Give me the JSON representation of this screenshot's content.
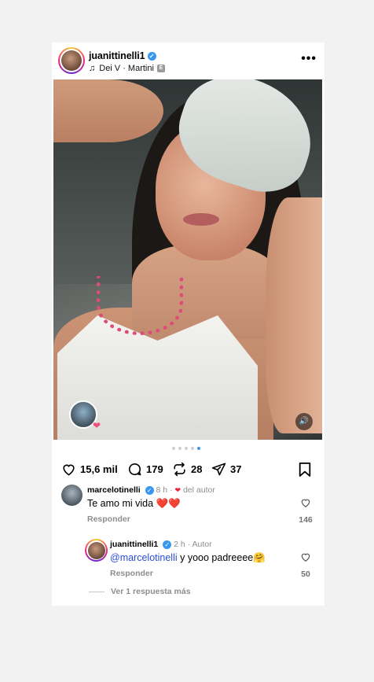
{
  "post": {
    "username": "juanittinelli1",
    "verified_mark": "✓",
    "music_note_icon": "♫",
    "music": "Dei V · Martini",
    "explicit_badge": "E",
    "more_icon": "•••"
  },
  "carousel": {
    "total": 5,
    "active_index": 4
  },
  "actions": {
    "likes": "15,6 mil",
    "comments": "179",
    "reposts": "28",
    "shares": "37"
  },
  "comments": [
    {
      "username": "marcelotinelli",
      "time": "8 h",
      "liked_by_author_heart": "❤",
      "liked_by_author_label": "del autor",
      "text": "Te amo mi vida ❤️❤️",
      "reply_label": "Responder",
      "likes": "146"
    },
    {
      "username": "juanittinelli1",
      "time": "2 h",
      "author_label": "Autor",
      "mention": "@marcelotinelli",
      "text": " y yooo padreeee🤗",
      "reply_label": "Responder",
      "likes": "50"
    }
  ],
  "more_replies": "Ver 1 respuesta más",
  "colors": {
    "verified": "#3897f0",
    "mention": "#2c4cd8",
    "heart_red": "#ed1c3a",
    "background": "#f2f2f2"
  }
}
